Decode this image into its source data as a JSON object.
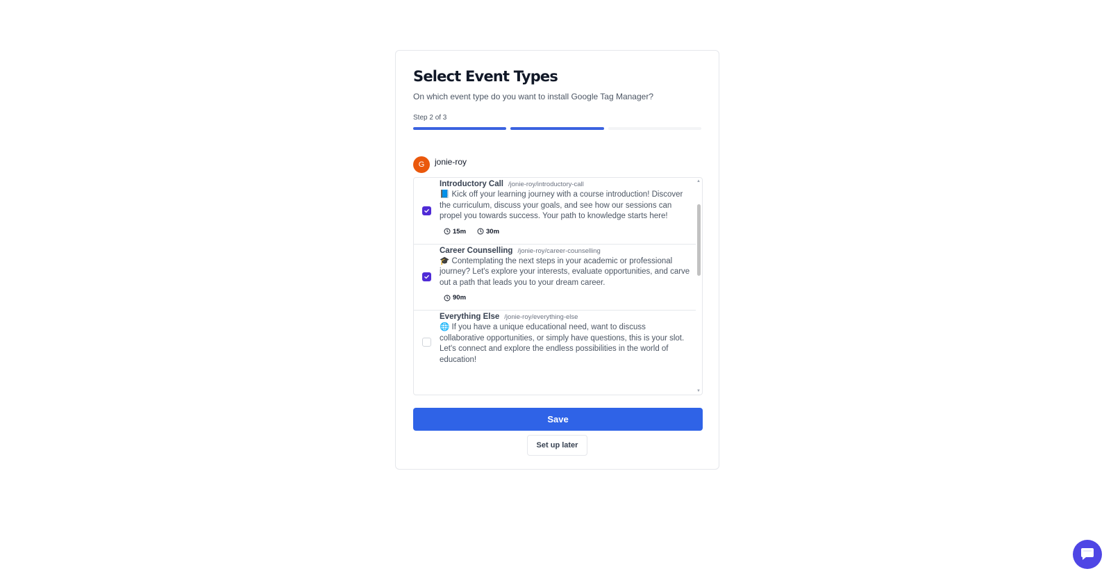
{
  "header": {
    "title": "Select Event Types",
    "subtitle": "On which event type do you want to install Google Tag Manager?",
    "step_label": "Step 2 of 3",
    "progress": {
      "current_step": 2,
      "total_steps": 3
    }
  },
  "user": {
    "avatar_letter": "G",
    "name": "jonie-roy",
    "avatar_color": "#ea580c"
  },
  "event_types": [
    {
      "title": "Introductory Call",
      "slug": "/jonie-roy/introductory-call",
      "description": "📘 Kick off your learning journey with a course introduction! Discover the curriculum, discuss your goals, and see how our sessions can propel you towards success. Your path to knowledge starts here!",
      "checked": true,
      "durations": [
        "15m",
        "30m"
      ]
    },
    {
      "title": "Career Counselling",
      "slug": "/jonie-roy/career-counselling",
      "description": "🎓 Contemplating the next steps in your academic or professional journey? Let's explore your interests, evaluate opportunities, and carve out a path that leads you to your dream career.",
      "checked": true,
      "durations": [
        "90m"
      ]
    },
    {
      "title": "Everything Else",
      "slug": "/jonie-roy/everything-else",
      "description": "🌐 If you have a unique educational need, want to discuss collaborative opportunities, or simply have questions, this is your slot. Let's connect and explore the endless possibilities in the world of education!",
      "checked": false,
      "durations": []
    }
  ],
  "actions": {
    "save_label": "Save",
    "later_label": "Set up later"
  },
  "colors": {
    "accent": "#2f63e7",
    "checkbox": "#4f2bd6",
    "progress_active": "#3b63e0",
    "chat_fab": "#4f46e5"
  },
  "icons": {
    "duration": "clock-icon",
    "chat": "chat-bubble-icon",
    "check": "check-icon"
  }
}
